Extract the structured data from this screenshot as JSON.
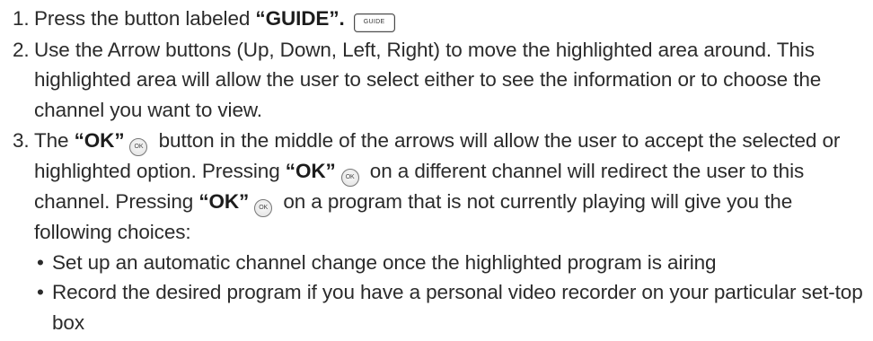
{
  "steps": [
    {
      "num": "1.",
      "pre": "Press the button labeled ",
      "bold": "“GUIDE”.",
      "button": "GUIDE"
    },
    {
      "num": "2.",
      "text": "Use the Arrow buttons (Up, Down, Left, Right) to move the highlighted area around. This highlighted area will allow the user to select either to see the information or to choose the channel you want to view."
    },
    {
      "num": "3.",
      "pre": "The ",
      "ok_label": "“OK”",
      "ok_button": "OK",
      "text_a": " button in the middle of the arrows will allow the user to accept the selected or highlighted option. Pressing ",
      "text_b": " on a different channel will redirect the user to this channel. Pressing ",
      "text_c": " on a program that is not currently playing will give you the following choices:"
    }
  ],
  "bullets": [
    {
      "marker": "•",
      "text": "Set up an automatic channel change once the highlighted program is airing"
    },
    {
      "marker": "•",
      "text": "Record the desired program if you have a personal video recorder on your particular set-top box"
    }
  ]
}
